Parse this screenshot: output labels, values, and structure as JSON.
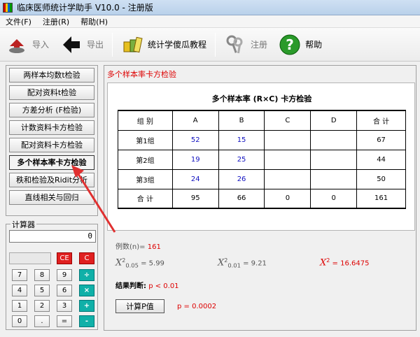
{
  "window": {
    "title": "临床医师统计学助手 V10.0 - 注册版"
  },
  "menu": [
    "文件(F)",
    "注册(R)",
    "帮助(H)"
  ],
  "toolbar": {
    "import_label": "导入",
    "export_label": "导出",
    "tutorial_label": "统计学傻瓜教程",
    "register_label": "注册",
    "help_label": "帮助"
  },
  "nav": [
    "两样本均数t检验",
    "配对资料t检验",
    "方差分析 (F检验)",
    "计数资料卡方检验",
    "配对资料卡方检验",
    "多个样本率卡方检验",
    "秩和检验及Ridit分析",
    "直线相关与回归"
  ],
  "calculator": {
    "legend": "计算器",
    "display": "0",
    "keys": {
      "ce": "CE",
      "c": "C",
      "k7": "7",
      "k8": "8",
      "k9": "9",
      "div": "÷",
      "k4": "4",
      "k5": "5",
      "k6": "6",
      "mul": "×",
      "k1": "1",
      "k2": "2",
      "k3": "3",
      "add": "+",
      "k0": "0",
      "dot": ".",
      "eq": "=",
      "sub": "-"
    }
  },
  "panel": {
    "title": "多个样本率卡方检验",
    "table_title": "多个样本率 (R×C) 卡方检验",
    "headers": [
      "组  别",
      "A",
      "B",
      "C",
      "D",
      "合  计"
    ],
    "rows": [
      [
        "第1组",
        "52",
        "15",
        "",
        "",
        "67"
      ],
      [
        "第2组",
        "19",
        "25",
        "",
        "",
        "44"
      ],
      [
        "第3组",
        "24",
        "26",
        "",
        "",
        "50"
      ],
      [
        "合  计",
        "95",
        "66",
        "0",
        "0",
        "161"
      ]
    ]
  },
  "results": {
    "n_label": "例数(n)=",
    "n_value": "161",
    "chi_symbol": "X",
    "chi_sup": "2",
    "chi005_sub": "0.05",
    "chi005_value": "= 5.99",
    "chi001_sub": "0.01",
    "chi001_value": "= 9.21",
    "chi_value": "=  16.6475",
    "judgement_label": "结果判断:",
    "judgement_value": "p < 0.01",
    "calc_button": "计算P值",
    "p_value": "p = 0.0002"
  },
  "colors": {
    "accent_red": "#d00000",
    "value_blue": "#1010c0",
    "key_teal": "#10b0a8"
  }
}
